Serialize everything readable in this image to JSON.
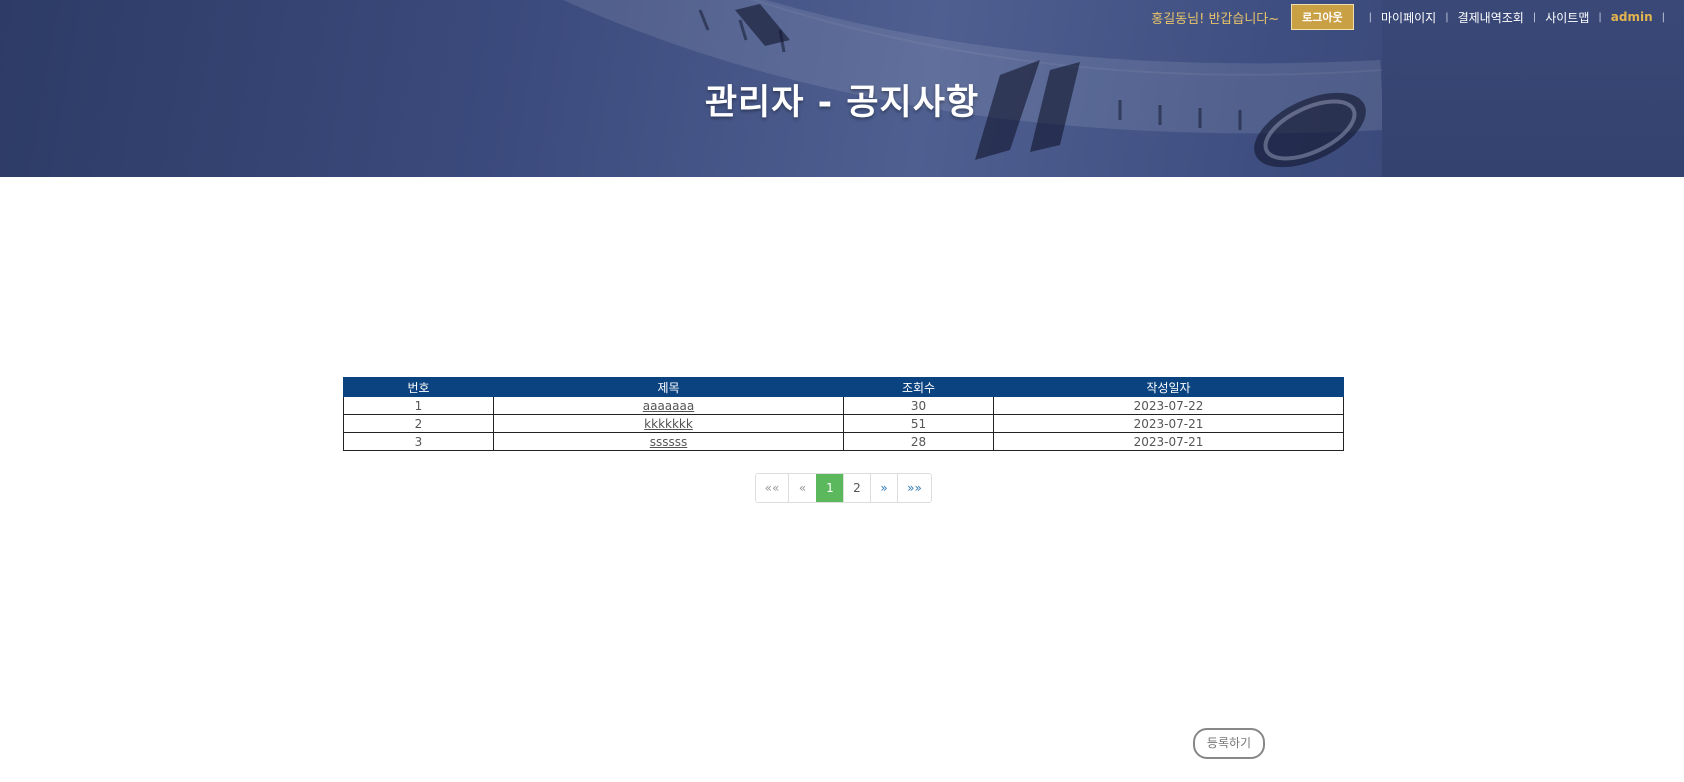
{
  "header": {
    "title": "관리자 - 공지사항",
    "greeting": "홍길동님! 반갑습니다~",
    "logout_label": "로그아웃",
    "nav": [
      {
        "label": "마이페이지"
      },
      {
        "label": "결제내역조회"
      },
      {
        "label": "사이트맵"
      },
      {
        "label": "admin"
      }
    ]
  },
  "table": {
    "columns": [
      "번호",
      "제목",
      "조회수",
      "작성일자"
    ],
    "rows": [
      {
        "no": "1",
        "title": "aaaaaaa",
        "views": "30",
        "date": "2023-07-22"
      },
      {
        "no": "2",
        "title": "kkkkkkk",
        "views": "51",
        "date": "2023-07-21"
      },
      {
        "no": "3",
        "title": "ssssss",
        "views": "28",
        "date": "2023-07-21"
      }
    ]
  },
  "pagination": {
    "first": "««",
    "prev": "«",
    "pages": [
      "1",
      "2"
    ],
    "current": "1",
    "next": "»",
    "last": "»»"
  },
  "register_label": "등록하기",
  "colors": {
    "banner": "#3b4a7c",
    "accent_gold": "#c9a044",
    "table_header": "#0b4380",
    "page_active": "#5cb85c"
  }
}
